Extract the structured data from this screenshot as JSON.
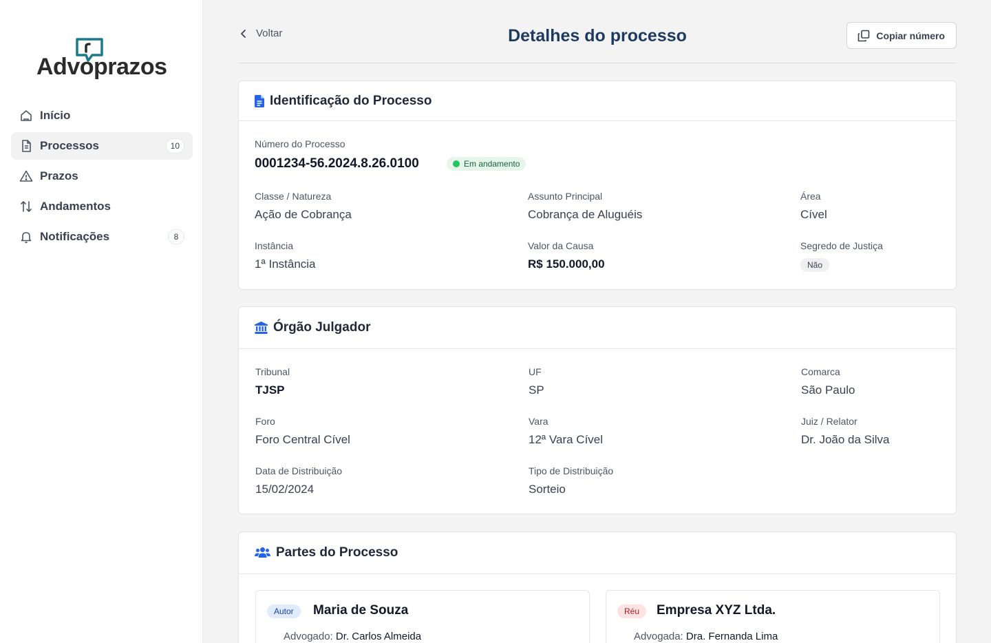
{
  "app": {
    "logo_text": "Advoprazos"
  },
  "sidebar": {
    "items": [
      {
        "label": "Início",
        "icon": "home-icon"
      },
      {
        "label": "Processos",
        "icon": "document-icon",
        "badge": "10",
        "active": true
      },
      {
        "label": "Prazos",
        "icon": "warning-icon"
      },
      {
        "label": "Andamentos",
        "icon": "arrows-updown-icon"
      },
      {
        "label": "Notificações",
        "icon": "bell-icon",
        "badge": "8"
      }
    ]
  },
  "header": {
    "back_label": "Voltar",
    "title": "Detalhes do processo",
    "copy_label": "Copiar número"
  },
  "identificacao": {
    "title": "Identificação do Processo",
    "numero_label": "Número do Processo",
    "numero": "0001234-56.2024.8.26.0100",
    "status": "Em andamento",
    "classe_label": "Classe / Natureza",
    "classe": "Ação de Cobrança",
    "assunto_label": "Assunto Principal",
    "assunto": "Cobrança de Aluguéis",
    "area_label": "Área",
    "area": "Cível",
    "instancia_label": "Instância",
    "instancia": "1ª Instância",
    "valor_label": "Valor da Causa",
    "valor": "R$ 150.000,00",
    "segredo_label": "Segredo de Justiça",
    "segredo": "Não"
  },
  "orgao": {
    "title": "Órgão Julgador",
    "tribunal_label": "Tribunal",
    "tribunal": "TJSP",
    "uf_label": "UF",
    "uf": "SP",
    "comarca_label": "Comarca",
    "comarca": "São Paulo",
    "foro_label": "Foro",
    "foro": "Foro Central Cível",
    "vara_label": "Vara",
    "vara": "12ª Vara Cível",
    "juiz_label": "Juiz / Relator",
    "juiz": "Dr. João da Silva",
    "data_label": "Data de Distribuição",
    "data": "15/02/2024",
    "tipo_label": "Tipo de Distribuição",
    "tipo": "Sorteio"
  },
  "partes": {
    "title": "Partes do Processo",
    "autor": {
      "role": "Autor",
      "name": "Maria de Souza",
      "adv_label": "Advogado:",
      "adv_name": "Dr. Carlos Almeida"
    },
    "reu": {
      "role": "Réu",
      "name": "Empresa XYZ Ltda.",
      "adv_label": "Advogada:",
      "adv_name": "Dra. Fernanda Lima"
    }
  },
  "colors": {
    "brand": "#1e3a5f",
    "accent": "#2563eb",
    "logo_mark": "#1a7a8c",
    "status_green": "#22c55e"
  }
}
